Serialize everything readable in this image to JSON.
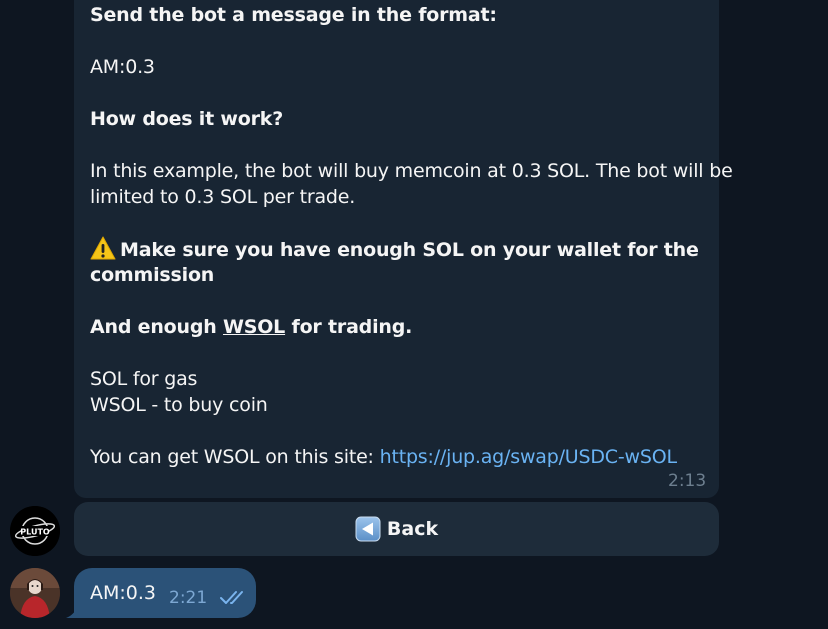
{
  "message": {
    "line1": "Send the bot a message in the format:",
    "line2": "AM:0.3",
    "line3": "How does it work?",
    "line4": "In this example, the bot will buy memcoin at 0.3 SOL. The bot will be",
    "line5": "limited to 0.3 SOL per trade.",
    "line6": "Make sure you have enough SOL on your wallet for the",
    "line7": "commission",
    "line8_before": "And enough ",
    "line8_link": "WSOL",
    "line8_after": " for trading.",
    "line9": "SOL for gas",
    "line10": "WSOL - to buy coin",
    "line11_before": "You can get WSOL on this site: ",
    "line11_link": "https://jup.ag/swap/USDC-wSOL",
    "time": "2:13",
    "warning_icon": "warning-icon"
  },
  "keyboard": {
    "back_label": "Back",
    "back_icon": "back-arrow-icon"
  },
  "outgoing": {
    "text": "AM:0.3",
    "time": "2:21",
    "status_icon": "double-check-icon"
  },
  "colors": {
    "background": "#0e1621",
    "bubble_in": "#182533",
    "bubble_out": "#2b5278",
    "link": "#6ab3f3",
    "button": "#1e2c3a"
  }
}
